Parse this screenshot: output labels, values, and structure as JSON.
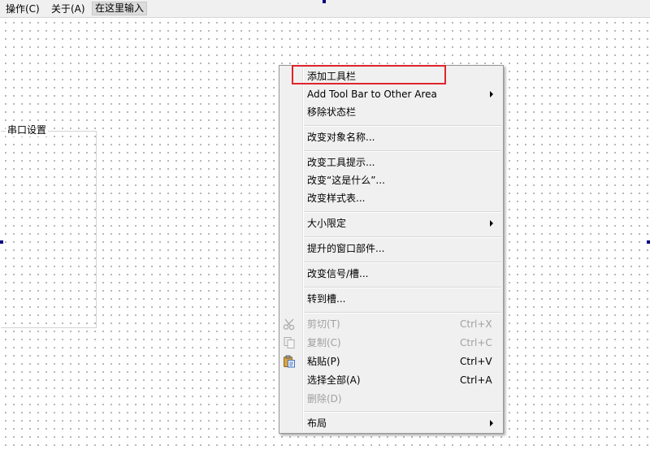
{
  "menubar": {
    "items": [
      "操作(C)",
      "关于(A)"
    ],
    "input_placeholder": "在这里输入"
  },
  "groupbox": {
    "title": "串口设置"
  },
  "context_menu": {
    "items": [
      {
        "label": "添加工具栏"
      },
      {
        "label": "Add Tool Bar to Other Area",
        "submenu": true
      },
      {
        "label": "移除状态栏"
      },
      {
        "label": "改变对象名称..."
      },
      {
        "label": "改变工具提示..."
      },
      {
        "label": "改变“这是什么”..."
      },
      {
        "label": "改变样式表..."
      },
      {
        "label": "大小限定",
        "submenu": true
      },
      {
        "label": "提升的窗口部件..."
      },
      {
        "label": "改变信号/槽..."
      },
      {
        "label": "转到槽..."
      },
      {
        "label": "剪切(T)",
        "shortcut": "Ctrl+X",
        "enabled": false,
        "icon": "scissors-icon"
      },
      {
        "label": "复制(C)",
        "shortcut": "Ctrl+C",
        "enabled": false,
        "icon": "copy-icon"
      },
      {
        "label": "粘贴(P)",
        "shortcut": "Ctrl+V",
        "enabled": true,
        "icon": "paste-icon"
      },
      {
        "label": "选择全部(A)",
        "shortcut": "Ctrl+A",
        "enabled": true
      },
      {
        "label": "删除(D)",
        "enabled": false
      },
      {
        "label": "布局",
        "submenu": true
      }
    ]
  },
  "colors": {
    "highlight_border": "#e0242b",
    "menu_background": "#f0f0f0",
    "disabled_text": "#a0a0a0",
    "selection_handle": "#00007f"
  }
}
